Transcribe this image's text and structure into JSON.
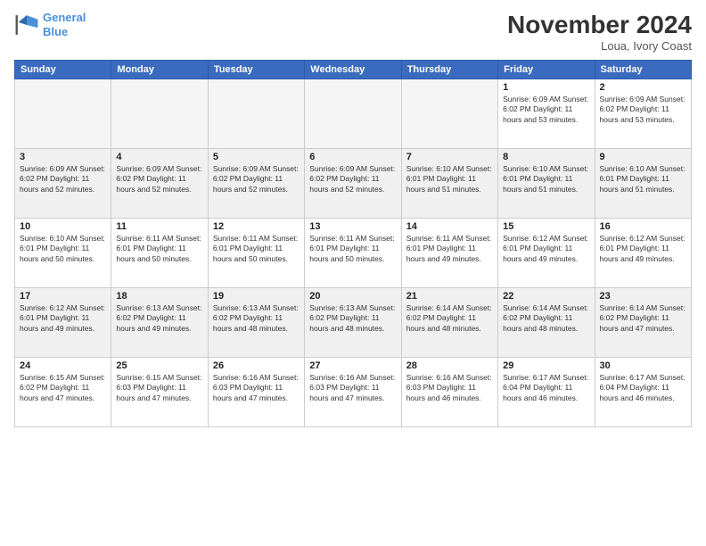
{
  "logo": {
    "line1": "General",
    "line2": "Blue"
  },
  "title": "November 2024",
  "location": "Loua, Ivory Coast",
  "days_of_week": [
    "Sunday",
    "Monday",
    "Tuesday",
    "Wednesday",
    "Thursday",
    "Friday",
    "Saturday"
  ],
  "weeks": [
    [
      {
        "day": "",
        "info": ""
      },
      {
        "day": "",
        "info": ""
      },
      {
        "day": "",
        "info": ""
      },
      {
        "day": "",
        "info": ""
      },
      {
        "day": "",
        "info": ""
      },
      {
        "day": "1",
        "info": "Sunrise: 6:09 AM\nSunset: 6:02 PM\nDaylight: 11 hours\nand 53 minutes."
      },
      {
        "day": "2",
        "info": "Sunrise: 6:09 AM\nSunset: 6:02 PM\nDaylight: 11 hours\nand 53 minutes."
      }
    ],
    [
      {
        "day": "3",
        "info": "Sunrise: 6:09 AM\nSunset: 6:02 PM\nDaylight: 11 hours\nand 52 minutes."
      },
      {
        "day": "4",
        "info": "Sunrise: 6:09 AM\nSunset: 6:02 PM\nDaylight: 11 hours\nand 52 minutes."
      },
      {
        "day": "5",
        "info": "Sunrise: 6:09 AM\nSunset: 6:02 PM\nDaylight: 11 hours\nand 52 minutes."
      },
      {
        "day": "6",
        "info": "Sunrise: 6:09 AM\nSunset: 6:02 PM\nDaylight: 11 hours\nand 52 minutes."
      },
      {
        "day": "7",
        "info": "Sunrise: 6:10 AM\nSunset: 6:01 PM\nDaylight: 11 hours\nand 51 minutes."
      },
      {
        "day": "8",
        "info": "Sunrise: 6:10 AM\nSunset: 6:01 PM\nDaylight: 11 hours\nand 51 minutes."
      },
      {
        "day": "9",
        "info": "Sunrise: 6:10 AM\nSunset: 6:01 PM\nDaylight: 11 hours\nand 51 minutes."
      }
    ],
    [
      {
        "day": "10",
        "info": "Sunrise: 6:10 AM\nSunset: 6:01 PM\nDaylight: 11 hours\nand 50 minutes."
      },
      {
        "day": "11",
        "info": "Sunrise: 6:11 AM\nSunset: 6:01 PM\nDaylight: 11 hours\nand 50 minutes."
      },
      {
        "day": "12",
        "info": "Sunrise: 6:11 AM\nSunset: 6:01 PM\nDaylight: 11 hours\nand 50 minutes."
      },
      {
        "day": "13",
        "info": "Sunrise: 6:11 AM\nSunset: 6:01 PM\nDaylight: 11 hours\nand 50 minutes."
      },
      {
        "day": "14",
        "info": "Sunrise: 6:11 AM\nSunset: 6:01 PM\nDaylight: 11 hours\nand 49 minutes."
      },
      {
        "day": "15",
        "info": "Sunrise: 6:12 AM\nSunset: 6:01 PM\nDaylight: 11 hours\nand 49 minutes."
      },
      {
        "day": "16",
        "info": "Sunrise: 6:12 AM\nSunset: 6:01 PM\nDaylight: 11 hours\nand 49 minutes."
      }
    ],
    [
      {
        "day": "17",
        "info": "Sunrise: 6:12 AM\nSunset: 6:01 PM\nDaylight: 11 hours\nand 49 minutes."
      },
      {
        "day": "18",
        "info": "Sunrise: 6:13 AM\nSunset: 6:02 PM\nDaylight: 11 hours\nand 49 minutes."
      },
      {
        "day": "19",
        "info": "Sunrise: 6:13 AM\nSunset: 6:02 PM\nDaylight: 11 hours\nand 48 minutes."
      },
      {
        "day": "20",
        "info": "Sunrise: 6:13 AM\nSunset: 6:02 PM\nDaylight: 11 hours\nand 48 minutes."
      },
      {
        "day": "21",
        "info": "Sunrise: 6:14 AM\nSunset: 6:02 PM\nDaylight: 11 hours\nand 48 minutes."
      },
      {
        "day": "22",
        "info": "Sunrise: 6:14 AM\nSunset: 6:02 PM\nDaylight: 11 hours\nand 48 minutes."
      },
      {
        "day": "23",
        "info": "Sunrise: 6:14 AM\nSunset: 6:02 PM\nDaylight: 11 hours\nand 47 minutes."
      }
    ],
    [
      {
        "day": "24",
        "info": "Sunrise: 6:15 AM\nSunset: 6:02 PM\nDaylight: 11 hours\nand 47 minutes."
      },
      {
        "day": "25",
        "info": "Sunrise: 6:15 AM\nSunset: 6:03 PM\nDaylight: 11 hours\nand 47 minutes."
      },
      {
        "day": "26",
        "info": "Sunrise: 6:16 AM\nSunset: 6:03 PM\nDaylight: 11 hours\nand 47 minutes."
      },
      {
        "day": "27",
        "info": "Sunrise: 6:16 AM\nSunset: 6:03 PM\nDaylight: 11 hours\nand 47 minutes."
      },
      {
        "day": "28",
        "info": "Sunrise: 6:16 AM\nSunset: 6:03 PM\nDaylight: 11 hours\nand 46 minutes."
      },
      {
        "day": "29",
        "info": "Sunrise: 6:17 AM\nSunset: 6:04 PM\nDaylight: 11 hours\nand 46 minutes."
      },
      {
        "day": "30",
        "info": "Sunrise: 6:17 AM\nSunset: 6:04 PM\nDaylight: 11 hours\nand 46 minutes."
      }
    ]
  ]
}
